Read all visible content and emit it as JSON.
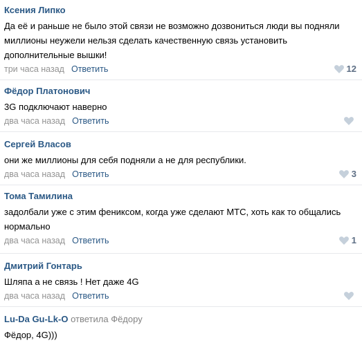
{
  "comments": [
    {
      "author": "Ксения Липко",
      "text": "Да её и раньше не было этой связи не возможно дозвониться люди вы подняли миллионы неужели нельзя сделать качественную связь установить дополнительные вышки!",
      "date": "три часа назад",
      "reply_label": "Ответить",
      "likes": "12"
    },
    {
      "author": "Фёдор Платонович",
      "text": "3G подключают наверно",
      "date": "два часа назад",
      "reply_label": "Ответить",
      "likes": ""
    },
    {
      "author": "Сергей Власов",
      "text": "они же миллионы для себя подняли а не для республики.",
      "date": "два часа назад",
      "reply_label": "Ответить",
      "likes": "3"
    },
    {
      "author": "Тома Тамилина",
      "text": "задолбали уже с этим фениксом, когда уже сделают МТС, хоть как то общались нормально",
      "date": "два часа назад",
      "reply_label": "Ответить",
      "likes": "1"
    },
    {
      "author": "Дмитрий Гонтарь",
      "text": "Шляпа а не связь ! Нет даже 4G",
      "date": "два часа назад",
      "reply_label": "Ответить",
      "likes": ""
    },
    {
      "author": "Lu-Da Gu-Lk-O",
      "reply_verb": "ответила",
      "reply_to": "Фёдору",
      "text": "Фёдор, 4G)))"
    }
  ],
  "colors": {
    "author": "#2a5885",
    "date": "#939393",
    "like_icon": "#c5d0db",
    "like_count": "#5e6f85",
    "divider": "#e7e8ec"
  },
  "icons": {
    "like": "heart-icon"
  }
}
